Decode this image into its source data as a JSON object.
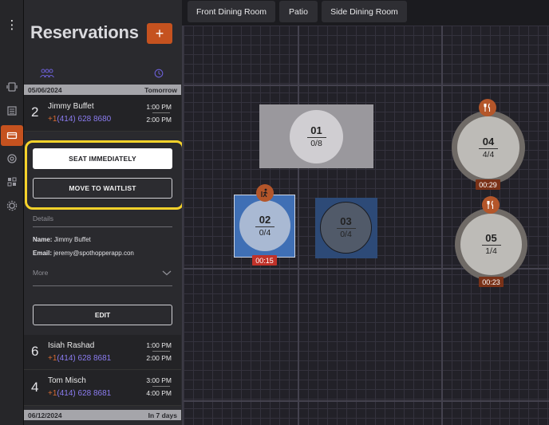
{
  "rail": {
    "icons": [
      "menu-dots-icon",
      "device-icon",
      "list-icon",
      "reservation-icon",
      "settings-alt-icon",
      "blocks-icon",
      "gear-icon"
    ],
    "menu_glyph": "⋮"
  },
  "panel": {
    "title": "Reservations",
    "add_label": "+",
    "date_bars": [
      {
        "date": "05/06/2024",
        "relative": "Tomorrow"
      },
      {
        "date": "06/12/2024",
        "relative": "In 7 days"
      }
    ],
    "selected": {
      "party": "2",
      "name": "Jimmy Buffet",
      "phone_cc": "+1",
      "phone": "(414) 628 8680",
      "start": "1:00 PM",
      "end": "2:00 PM"
    },
    "actions": {
      "seat": "SEAT IMMEDIATELY",
      "waitlist": "MOVE TO WAITLIST"
    },
    "details_label": "Details",
    "name_label": "Name:",
    "name_value": "Jimmy Buffet",
    "email_label": "Email:",
    "email_value": "jeremy@spothopperapp.con",
    "more_label": "More",
    "edit_label": "EDIT",
    "others": [
      {
        "party": "6",
        "name": "Isiah Rashad",
        "phone_cc": "+1",
        "phone": "(414) 628 8681",
        "start": "1:00 PM",
        "end": "2:00 PM"
      },
      {
        "party": "4",
        "name": "Tom Misch",
        "phone_cc": "+1",
        "phone": "(414) 628 8681",
        "start": "3:00 PM",
        "end": "4:00 PM"
      }
    ]
  },
  "tabs": [
    "Front Dining Room",
    "Patio",
    "Side Dining Room"
  ],
  "tables": [
    {
      "id": "01",
      "capacity": "0/8",
      "shape": "rect",
      "status": "available",
      "fill": "#9a989d"
    },
    {
      "id": "02",
      "capacity": "0/4",
      "shape": "rect",
      "status": "selected",
      "fill": "#3f6fb5",
      "timer": "00:15",
      "timer_color": "#c0322a",
      "icon": "waiting-person-icon"
    },
    {
      "id": "03",
      "capacity": "0/4",
      "shape": "rect",
      "status": "blue",
      "fill": "#2d4a77"
    },
    {
      "id": "04",
      "capacity": "4/4",
      "shape": "circle",
      "status": "occupied",
      "fill": "#6f6a66",
      "timer": "00:29",
      "timer_color": "#7a3218",
      "icon": "utensils-icon"
    },
    {
      "id": "05",
      "capacity": "1/4",
      "shape": "circle",
      "status": "occupied",
      "fill": "#6f6a66",
      "timer": "00:23",
      "timer_color": "#7a3218",
      "icon": "utensils-icon"
    }
  ],
  "colors": {
    "accent": "#c5521f",
    "highlight": "#f5d22a",
    "phone_number": "#8b7cf0"
  }
}
